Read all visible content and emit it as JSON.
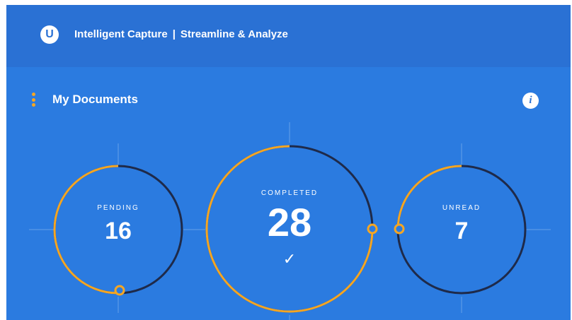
{
  "header": {
    "logo_letter": "U",
    "app_name": "Intelligent Capture",
    "separator": "|",
    "tagline": "Streamline & Analyze"
  },
  "section": {
    "title": "My Documents"
  },
  "info_icon": "i",
  "stats": [
    {
      "label": "PENDING",
      "value": "16"
    },
    {
      "label": "COMPLETED",
      "value": "28",
      "check": "✓"
    },
    {
      "label": "UNREAD",
      "value": "7"
    }
  ],
  "colors": {
    "background": "#2b7be0",
    "header": "#2a71d4",
    "accent": "#f5a623",
    "ring_dark": "#1e2a4a"
  }
}
